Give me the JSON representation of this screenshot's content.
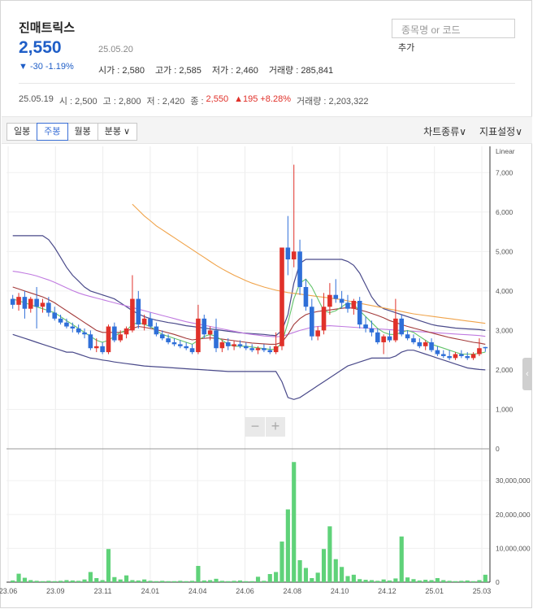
{
  "stock": {
    "name": "진매트릭스",
    "price": "2,550",
    "change": "▼ -30 -1.19%",
    "date": "25.05.20",
    "open": "시가 : 2,580",
    "high": "고가 : 2,585",
    "low": "저가 : 2,460",
    "volume": "거래량 : 285,841"
  },
  "search": {
    "placeholder": "종목명 or 코드",
    "add_label": "추가"
  },
  "prev": {
    "date": "25.05.19",
    "open": "시 : 2,500",
    "high": "고 : 2,800",
    "low": "저 : 2,420",
    "close_label": "종 :",
    "close": "2,550",
    "change": "▲195 +8.28%",
    "volume": "거래량 : 2,203,322"
  },
  "toolbar": {
    "tabs": [
      "일봉",
      "주봉",
      "월봉",
      "분봉 ∨"
    ],
    "active_tab": "주봉",
    "chart_type": "차트종류∨",
    "indicator": "지표설정∨"
  },
  "zoom": {
    "minus": "−",
    "plus": "+"
  },
  "chart_data": {
    "type": "candlestick",
    "scale": "Linear",
    "price_ticks": [
      "7,000",
      "6,000",
      "5,000",
      "4,000",
      "3,000",
      "2,000",
      "1,000",
      "0"
    ],
    "volume_ticks": [
      "30,000,000",
      "20,000,000",
      "10,000,000",
      "0"
    ],
    "x_labels": [
      "23.06",
      "23.09",
      "23.11",
      "24.01",
      "24.04",
      "24.06",
      "24.08",
      "24.10",
      "24.12",
      "25.01",
      "25.03"
    ],
    "ylim": [
      0,
      7500
    ],
    "volume_lim": [
      0,
      37000000
    ],
    "colors": {
      "up": "#e0312a",
      "down": "#2f6fd8",
      "volume": "#5fd279",
      "ma_orange": "#f0a34a",
      "ma_purple": "#c07ae0",
      "ma_red": "#a33a3a",
      "ma_green": "#63c46a",
      "bollinger": "#4a4a8a"
    },
    "candles": [
      {
        "o": 3800,
        "h": 3900,
        "l": 3550,
        "c": 3650
      },
      {
        "o": 3650,
        "h": 3950,
        "l": 3500,
        "c": 3850
      },
      {
        "o": 3850,
        "h": 4000,
        "l": 3300,
        "c": 3550
      },
      {
        "o": 3550,
        "h": 3850,
        "l": 3450,
        "c": 3800
      },
      {
        "o": 3800,
        "h": 4100,
        "l": 3050,
        "c": 3600
      },
      {
        "o": 3600,
        "h": 3800,
        "l": 3450,
        "c": 3700
      },
      {
        "o": 3700,
        "h": 3850,
        "l": 3350,
        "c": 3450
      },
      {
        "o": 3450,
        "h": 3600,
        "l": 3250,
        "c": 3300
      },
      {
        "o": 3300,
        "h": 3400,
        "l": 3150,
        "c": 3200
      },
      {
        "o": 3200,
        "h": 3300,
        "l": 3050,
        "c": 3100
      },
      {
        "o": 3100,
        "h": 3200,
        "l": 2950,
        "c": 3050
      },
      {
        "o": 3050,
        "h": 3150,
        "l": 2900,
        "c": 2950
      },
      {
        "o": 2950,
        "h": 3050,
        "l": 2800,
        "c": 2900
      },
      {
        "o": 2900,
        "h": 3000,
        "l": 2500,
        "c": 2550
      },
      {
        "o": 2550,
        "h": 2800,
        "l": 2450,
        "c": 2600
      },
      {
        "o": 2600,
        "h": 2700,
        "l": 2400,
        "c": 2450
      },
      {
        "o": 2450,
        "h": 3150,
        "l": 2400,
        "c": 3100
      },
      {
        "o": 3100,
        "h": 3200,
        "l": 2700,
        "c": 2750
      },
      {
        "o": 2750,
        "h": 3000,
        "l": 2700,
        "c": 2900
      },
      {
        "o": 2900,
        "h": 3100,
        "l": 2800,
        "c": 3050
      },
      {
        "o": 3000,
        "h": 4400,
        "l": 2950,
        "c": 3800
      },
      {
        "o": 3800,
        "h": 4000,
        "l": 3050,
        "c": 3150
      },
      {
        "o": 3150,
        "h": 3400,
        "l": 3000,
        "c": 3300
      },
      {
        "o": 3300,
        "h": 3450,
        "l": 3050,
        "c": 3100
      },
      {
        "o": 3100,
        "h": 3200,
        "l": 2850,
        "c": 2900
      },
      {
        "o": 2900,
        "h": 3000,
        "l": 2750,
        "c": 2800
      },
      {
        "o": 2800,
        "h": 2900,
        "l": 2650,
        "c": 2700
      },
      {
        "o": 2700,
        "h": 2800,
        "l": 2600,
        "c": 2650
      },
      {
        "o": 2650,
        "h": 2750,
        "l": 2550,
        "c": 2600
      },
      {
        "o": 2600,
        "h": 2700,
        "l": 2500,
        "c": 2550
      },
      {
        "o": 2550,
        "h": 2650,
        "l": 2400,
        "c": 2450
      },
      {
        "o": 2450,
        "h": 3650,
        "l": 2400,
        "c": 3300
      },
      {
        "o": 3300,
        "h": 3400,
        "l": 2800,
        "c": 2900
      },
      {
        "o": 2900,
        "h": 3100,
        "l": 2750,
        "c": 3000
      },
      {
        "o": 3000,
        "h": 3300,
        "l": 2450,
        "c": 2550
      },
      {
        "o": 2550,
        "h": 2750,
        "l": 2450,
        "c": 2700
      },
      {
        "o": 2700,
        "h": 2800,
        "l": 2500,
        "c": 2600
      },
      {
        "o": 2600,
        "h": 2750,
        "l": 2500,
        "c": 2650
      },
      {
        "o": 2650,
        "h": 2750,
        "l": 2550,
        "c": 2600
      },
      {
        "o": 2600,
        "h": 2700,
        "l": 2500,
        "c": 2550
      },
      {
        "o": 2550,
        "h": 2650,
        "l": 2450,
        "c": 2500
      },
      {
        "o": 2500,
        "h": 2600,
        "l": 2400,
        "c": 2550
      },
      {
        "o": 2550,
        "h": 2650,
        "l": 2450,
        "c": 2500
      },
      {
        "o": 2500,
        "h": 2600,
        "l": 2400,
        "c": 2450
      },
      {
        "o": 2450,
        "h": 2950,
        "l": 2400,
        "c": 2600
      },
      {
        "o": 2600,
        "h": 3800,
        "l": 2500,
        "c": 5100
      },
      {
        "o": 5100,
        "h": 5900,
        "l": 4400,
        "c": 4800
      },
      {
        "o": 4800,
        "h": 7200,
        "l": 4600,
        "c": 5000
      },
      {
        "o": 5000,
        "h": 5300,
        "l": 3900,
        "c": 4100
      },
      {
        "o": 4100,
        "h": 4300,
        "l": 3500,
        "c": 3600
      },
      {
        "o": 3600,
        "h": 3800,
        "l": 2750,
        "c": 2850
      },
      {
        "o": 2850,
        "h": 3100,
        "l": 2750,
        "c": 3000
      },
      {
        "o": 3000,
        "h": 3950,
        "l": 2900,
        "c": 3600
      },
      {
        "o": 3600,
        "h": 4200,
        "l": 3400,
        "c": 3900
      },
      {
        "o": 3900,
        "h": 4300,
        "l": 3700,
        "c": 3800
      },
      {
        "o": 3800,
        "h": 4000,
        "l": 3550,
        "c": 3700
      },
      {
        "o": 3700,
        "h": 3900,
        "l": 3450,
        "c": 3550
      },
      {
        "o": 3550,
        "h": 3800,
        "l": 3400,
        "c": 3750
      },
      {
        "o": 3750,
        "h": 3850,
        "l": 3050,
        "c": 3150
      },
      {
        "o": 3150,
        "h": 3350,
        "l": 2950,
        "c": 3050
      },
      {
        "o": 3050,
        "h": 3250,
        "l": 2850,
        "c": 2950
      },
      {
        "o": 2950,
        "h": 3050,
        "l": 2650,
        "c": 2700
      },
      {
        "o": 2700,
        "h": 2900,
        "l": 2400,
        "c": 2850
      },
      {
        "o": 2850,
        "h": 3000,
        "l": 2700,
        "c": 2750
      },
      {
        "o": 2750,
        "h": 3800,
        "l": 2700,
        "c": 3300
      },
      {
        "o": 3300,
        "h": 3400,
        "l": 2850,
        "c": 2900
      },
      {
        "o": 2900,
        "h": 3000,
        "l": 2750,
        "c": 2800
      },
      {
        "o": 2800,
        "h": 2900,
        "l": 2650,
        "c": 2700
      },
      {
        "o": 2700,
        "h": 2800,
        "l": 2550,
        "c": 2600
      },
      {
        "o": 2600,
        "h": 2750,
        "l": 2500,
        "c": 2700
      },
      {
        "o": 2700,
        "h": 2800,
        "l": 2450,
        "c": 2500
      },
      {
        "o": 2500,
        "h": 2600,
        "l": 2350,
        "c": 2400
      },
      {
        "o": 2400,
        "h": 2500,
        "l": 2300,
        "c": 2350
      },
      {
        "o": 2350,
        "h": 2500,
        "l": 2250,
        "c": 2300
      },
      {
        "o": 2300,
        "h": 2450,
        "l": 2250,
        "c": 2400
      },
      {
        "o": 2400,
        "h": 2500,
        "l": 2300,
        "c": 2350
      },
      {
        "o": 2350,
        "h": 2450,
        "l": 2250,
        "c": 2300
      },
      {
        "o": 2300,
        "h": 2450,
        "l": 2250,
        "c": 2400
      },
      {
        "o": 2400,
        "h": 2800,
        "l": 2350,
        "c": 2550
      },
      {
        "o": 2580,
        "h": 2585,
        "l": 2460,
        "c": 2550
      }
    ],
    "volumes": [
      0.5,
      2.5,
      1.3,
      0.6,
      0.4,
      0.3,
      0.4,
      0.3,
      0.4,
      0.6,
      0.5,
      0.4,
      0.8,
      3,
      1.2,
      0.6,
      9.8,
      1.5,
      0.8,
      2,
      0.6,
      0.5,
      0.8,
      0.4,
      0.3,
      0.4,
      0.3,
      0.3,
      0.4,
      0.3,
      0.4,
      4.8,
      0.5,
      0.6,
      1,
      0.4,
      0.3,
      0.4,
      0.5,
      0.3,
      0.3,
      1.6,
      0.4,
      2.4,
      3,
      12,
      21.5,
      35.5,
      6.5,
      4.2,
      1.2,
      2.8,
      9.8,
      16.5,
      6.8,
      4.5,
      1.8,
      2.2,
      0.9,
      0.7,
      0.6,
      0.4,
      0.8,
      0.5,
      1.1,
      13.5,
      1.4,
      0.9,
      0.5,
      0.7,
      0.6,
      1.2,
      0.6,
      0.4,
      0.3,
      0.4,
      0.5,
      0.3,
      0.6,
      2.2
    ],
    "ma_orange": [
      null,
      null,
      null,
      null,
      null,
      null,
      null,
      null,
      null,
      null,
      null,
      null,
      null,
      null,
      null,
      null,
      null,
      null,
      null,
      null,
      6200,
      6050,
      5900,
      5780,
      5650,
      5550,
      5450,
      5350,
      5250,
      5150,
      5050,
      4950,
      4850,
      4750,
      4650,
      4560,
      4480,
      4400,
      4330,
      4260,
      4200,
      4150,
      4100,
      4060,
      4020,
      3990,
      3960,
      3940,
      3920,
      3900,
      3880,
      3860,
      3840,
      3820,
      3800,
      3780,
      3750,
      3720,
      3690,
      3660,
      3630,
      3600,
      3570,
      3540,
      3510,
      3480,
      3450,
      3420,
      3400,
      3380,
      3360,
      3340,
      3320,
      3300,
      3280,
      3260,
      3240,
      3220,
      3200,
      3180
    ],
    "ma_purple": [
      4500,
      4480,
      4450,
      4420,
      4380,
      4330,
      4280,
      4220,
      4150,
      4080,
      4010,
      3950,
      3900,
      3860,
      3820,
      3780,
      3740,
      3700,
      3660,
      3620,
      3580,
      3540,
      3500,
      3460,
      3420,
      3380,
      3340,
      3300,
      3260,
      3220,
      3190,
      3160,
      3130,
      3100,
      3070,
      3040,
      3010,
      2980,
      2950,
      2920,
      2900,
      2880,
      2860,
      2850,
      2840,
      2850,
      2900,
      2950,
      3000,
      3040,
      3080,
      3100,
      3110,
      3120,
      3110,
      3100,
      3090,
      3080,
      3070,
      3060,
      3050,
      3040,
      3030,
      3020,
      3010,
      3000,
      2990,
      2980,
      2970,
      2960,
      2950,
      2940,
      2930,
      2920,
      2910,
      2900,
      2890,
      2880,
      2870,
      2850
    ],
    "ma_red": [
      4100,
      4050,
      4000,
      3950,
      3900,
      3850,
      3780,
      3700,
      3600,
      3500,
      3400,
      3300,
      3200,
      3100,
      3000,
      2950,
      2950,
      2950,
      2950,
      2980,
      3050,
      3100,
      3080,
      3050,
      3020,
      2980,
      2940,
      2900,
      2850,
      2800,
      2760,
      2780,
      2800,
      2810,
      2800,
      2780,
      2760,
      2740,
      2720,
      2700,
      2680,
      2670,
      2660,
      2650,
      2650,
      2700,
      2900,
      3150,
      3300,
      3400,
      3450,
      3480,
      3500,
      3520,
      3540,
      3560,
      3580,
      3560,
      3520,
      3480,
      3430,
      3380,
      3320,
      3250,
      3200,
      3150,
      3100,
      3060,
      3020,
      2980,
      2940,
      2900,
      2860,
      2820,
      2790,
      2760,
      2730,
      2700,
      2680,
      2650
    ],
    "ma_green": [
      3800,
      3750,
      3700,
      3650,
      3600,
      3550,
      3500,
      3450,
      3350,
      3250,
      3150,
      3050,
      2950,
      2850,
      2750,
      2700,
      2750,
      2850,
      2950,
      3000,
      3150,
      3200,
      3150,
      3100,
      3000,
      2900,
      2850,
      2800,
      2750,
      2700,
      2650,
      2750,
      2850,
      2900,
      2850,
      2750,
      2650,
      2600,
      2600,
      2600,
      2580,
      2560,
      2540,
      2520,
      2520,
      2700,
      3200,
      3800,
      4200,
      4300,
      4100,
      3800,
      3500,
      3450,
      3500,
      3600,
      3700,
      3650,
      3500,
      3350,
      3200,
      3050,
      2950,
      2900,
      2900,
      2950,
      3000,
      2950,
      2850,
      2750,
      2650,
      2600,
      2550,
      2500,
      2450,
      2400,
      2400,
      2400,
      2420,
      2450
    ],
    "bb_upper": [
      5400,
      5400,
      5400,
      5400,
      5400,
      5400,
      5300,
      5100,
      4850,
      4600,
      4400,
      4250,
      4100,
      4000,
      3950,
      3900,
      3850,
      3800,
      3700,
      3600,
      3500,
      3420,
      3350,
      3300,
      3260,
      3230,
      3200,
      3180,
      3150,
      3120,
      3100,
      3080,
      3060,
      3040,
      3020,
      3000,
      2980,
      2960,
      2940,
      2930,
      2920,
      2910,
      2900,
      2880,
      2870,
      3000,
      3400,
      4200,
      4700,
      4800,
      4800,
      4800,
      4800,
      4800,
      4800,
      4800,
      4750,
      4650,
      4450,
      4150,
      3850,
      3650,
      3550,
      3500,
      3450,
      3400,
      3350,
      3300,
      3250,
      3200,
      3150,
      3120,
      3100,
      3080,
      3060,
      3050,
      3040,
      3030,
      3020,
      3000
    ],
    "bb_lower": [
      2900,
      2850,
      2800,
      2750,
      2700,
      2650,
      2600,
      2550,
      2500,
      2450,
      2450,
      2400,
      2350,
      2300,
      2280,
      2250,
      2230,
      2200,
      2180,
      2160,
      2140,
      2120,
      2100,
      2090,
      2080,
      2070,
      2060,
      2050,
      2040,
      2030,
      2020,
      2010,
      2000,
      1990,
      1980,
      1970,
      1960,
      1960,
      1960,
      1960,
      1960,
      1960,
      1960,
      1960,
      1960,
      1700,
      1300,
      1250,
      1300,
      1400,
      1500,
      1600,
      1700,
      1800,
      1900,
      2000,
      2100,
      2150,
      2200,
      2250,
      2300,
      2300,
      2300,
      2300,
      2350,
      2450,
      2500,
      2500,
      2450,
      2400,
      2350,
      2300,
      2250,
      2200,
      2150,
      2100,
      2050,
      2030,
      2010,
      2000
    ]
  }
}
